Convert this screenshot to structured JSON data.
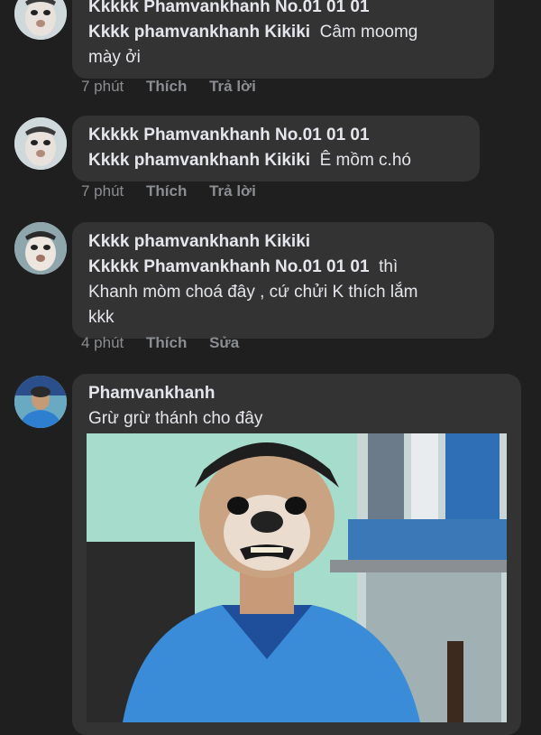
{
  "comments": [
    {
      "tag_line": "Kkkkk Phamvankhanh No.01 01 01",
      "author": "Kkkk phamvankhanh Kikiki",
      "text_1": "Câm moomg",
      "text_2": "mày ởi",
      "time": "7 phút",
      "like": "Thích",
      "reply": "Trả lời"
    },
    {
      "tag_line": "Kkkkk Phamvankhanh No.01 01 01",
      "author": "Kkkk phamvankhanh Kikiki",
      "text_1": "Ê mồm c.hó",
      "time": "7 phút",
      "like": "Thích",
      "reply": "Trả lời"
    },
    {
      "author": "Kkkk phamvankhanh Kikiki",
      "tag_line": "Kkkkk Phamvankhanh No.01 01 01",
      "text_1": "thì",
      "text_2": "Khanh mòm choá đây , cứ chửi K thích lắm",
      "text_3": "kkk",
      "time": "4 phút",
      "like": "Thích",
      "edit": "Sửa"
    },
    {
      "author": "Phamvankhanh",
      "text_1": "Grừ grừ thánh cho đây"
    }
  ],
  "icons": {
    "avatar_dog": "dog-face-avatar-icon",
    "avatar_man": "man-avatar-icon"
  },
  "colors": {
    "background": "#1f1f1f",
    "bubble": "#333334",
    "meta_text": "#8a8d91"
  }
}
